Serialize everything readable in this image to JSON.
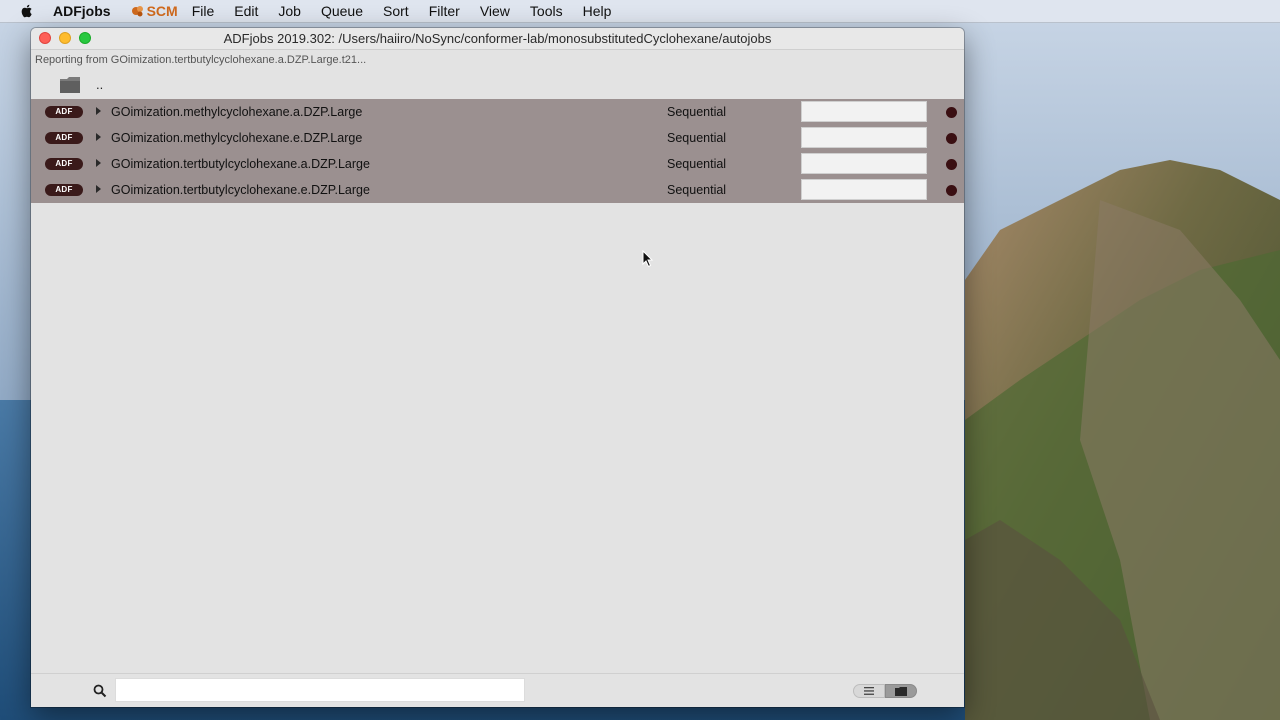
{
  "menubar": {
    "app_name": "ADFjobs",
    "brand": "SCM",
    "items": [
      "File",
      "Edit",
      "Job",
      "Queue",
      "Sort",
      "Filter",
      "View",
      "Tools",
      "Help"
    ]
  },
  "window": {
    "title": "ADFjobs 2019.302: /Users/haiiro/NoSync/conformer-lab/monosubstitutedCyclohexane/autojobs",
    "status": "Reporting from GOimization.tertbutylcyclohexane.a.DZP.Large.t21...",
    "parent_dir": ".."
  },
  "jobs": [
    {
      "badge": "ADF",
      "name": "GOimization.methylcyclohexane.a.DZP.Large",
      "queue": "Sequential"
    },
    {
      "badge": "ADF",
      "name": "GOimization.methylcyclohexane.e.DZP.Large",
      "queue": "Sequential"
    },
    {
      "badge": "ADF",
      "name": "GOimization.tertbutylcyclohexane.a.DZP.Large",
      "queue": "Sequential"
    },
    {
      "badge": "ADF",
      "name": "GOimization.tertbutylcyclohexane.e.DZP.Large",
      "queue": "Sequential"
    }
  ],
  "search": {
    "value": "",
    "placeholder": ""
  },
  "colors": {
    "job_row_bg": "#9b9090",
    "status_dot": "#3a0f12",
    "brand_orange": "#d06a1e"
  }
}
